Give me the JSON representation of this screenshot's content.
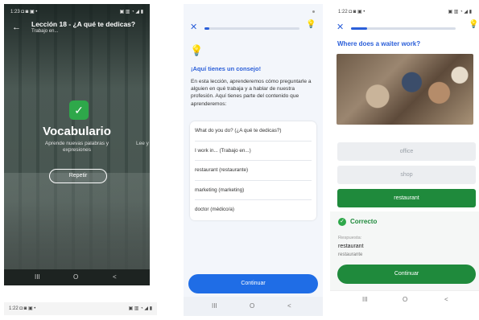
{
  "phone1": {
    "status_time": "1:23",
    "status_icons": "◘ ◙ ▣ •",
    "status_right": "▣ ▥ ◔ ◢ ▮",
    "lesson_title": "Lección 18 - ¿A qué te dedicas?",
    "lesson_subtitle": "Trabajo en...",
    "section_title": "Vocabulario",
    "section_subtitle": "Aprende nuevas palabras y expresiones",
    "peek_text": "Lee y",
    "repeat_label": "Repetir",
    "icons": {
      "back": "arrow-left-icon",
      "check": "check-icon"
    }
  },
  "phone2": {
    "progress": 0.05,
    "tip_title": "¡Aquí tienes un consejo!",
    "tip_body": "En esta lección, aprenderemos cómo preguntarle a alguien en qué trabaja y a hablar de nuestra profesión. Aquí tienes parte del contenido que aprenderemos:",
    "vocab_items": [
      "What do you do? (¿A qué te dedicas?)",
      "I work in... (Trabajo en...)",
      "restaurant (restaurante)",
      "marketing (marketing)",
      "doctor (médico/a)"
    ],
    "continue_label": "Continuar",
    "colors": {
      "accent": "#1f6de6"
    }
  },
  "phone3": {
    "status_time": "1:22",
    "status_icons": "◘ ◙ ▣ •",
    "status_right": "▣ ▥ ◔ ◢ ▮",
    "progress": 0.15,
    "question": "Where does a waiter work?",
    "options": [
      {
        "label": "office",
        "state": "disabled"
      },
      {
        "label": "shop",
        "state": "disabled"
      },
      {
        "label": "restaurant",
        "state": "selected"
      }
    ],
    "result_title": "Correcto",
    "answer_label": "Respuesta:",
    "answer": "restaurant",
    "answer_translation": "restaurante",
    "continue_label": "Continuar",
    "colors": {
      "correct": "#1f8a3c"
    }
  },
  "nav": {
    "recents": "III",
    "home": "O",
    "back": "<"
  },
  "bottom_status": {
    "time": "1:22",
    "icons": "◘ ◙ ▣ •",
    "right": "▣ ▥ ◔ ◢ ▮"
  }
}
